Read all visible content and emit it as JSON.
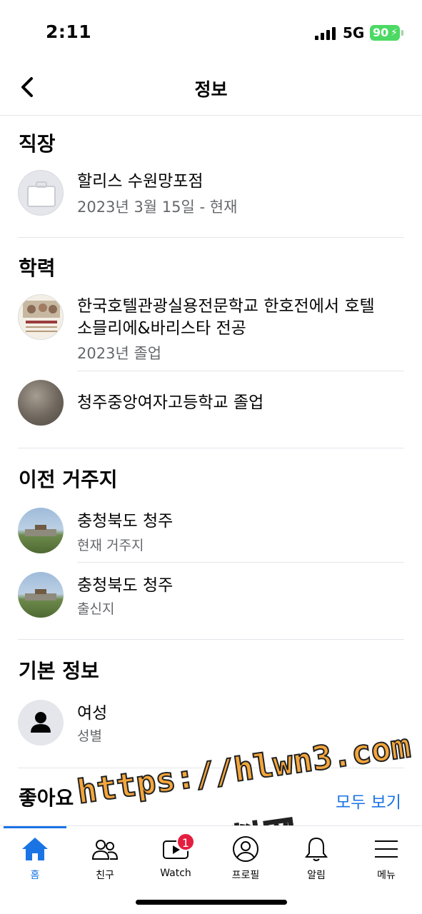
{
  "status": {
    "time": "2:11",
    "network": "5G",
    "battery": "90"
  },
  "header": {
    "title": "정보"
  },
  "work": {
    "section": "직장",
    "items": [
      {
        "title": "할리스 수원망포점",
        "sub": "2023년 3월 15일 - 현재"
      }
    ]
  },
  "education": {
    "section": "학력",
    "items": [
      {
        "title_line1": "한국호텔관광실용전문학교 한호전에서 호텔",
        "title_line2": "소믈리에&바리스타 전공",
        "sub": "2023년 졸업"
      },
      {
        "title": "청주중앙여자고등학교 졸업"
      }
    ]
  },
  "places": {
    "section": "이전 거주지",
    "items": [
      {
        "title": "충청북도 청주",
        "sub": "현재 거주지"
      },
      {
        "title": "충청북도 청주",
        "sub": "출신지"
      }
    ]
  },
  "basic": {
    "section": "기본 정보",
    "items": [
      {
        "title": "여성",
        "sub": "성별"
      }
    ]
  },
  "likes": {
    "section": "좋아요",
    "see_all": "모두 보기"
  },
  "watermark": {
    "line1": "https://hlwn3.com",
    "line2": "黑料网"
  },
  "tabs": [
    {
      "label": "홈",
      "icon": "home-icon",
      "active": true
    },
    {
      "label": "친구",
      "icon": "friends-icon"
    },
    {
      "label": "Watch",
      "icon": "watch-icon",
      "badge": "1"
    },
    {
      "label": "프로필",
      "icon": "profile-icon"
    },
    {
      "label": "알림",
      "icon": "bell-icon"
    },
    {
      "label": "메뉴",
      "icon": "menu-icon"
    }
  ],
  "colors": {
    "accent": "#1b74e4",
    "secondary_text": "#65676b",
    "badge": "#e41e3f",
    "battery": "#4cd964"
  }
}
